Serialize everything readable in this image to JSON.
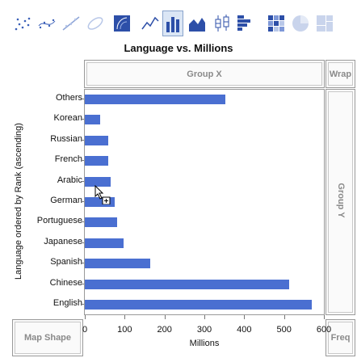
{
  "toolbar": {
    "buttons": [
      {
        "icon": "points-icon",
        "selected": false
      },
      {
        "icon": "smoother-icon",
        "selected": false
      },
      {
        "icon": "line-of-fit-icon",
        "selected": false
      },
      {
        "icon": "ellipse-icon",
        "selected": false
      },
      {
        "icon": "contour-icon",
        "selected": false
      },
      {
        "icon": "line-icon",
        "selected": false
      },
      {
        "icon": "bar-icon",
        "selected": true
      },
      {
        "icon": "area-icon",
        "selected": false
      },
      {
        "icon": "box-plot-icon",
        "selected": false
      },
      {
        "icon": "histogram-icon",
        "selected": false
      },
      {
        "icon": "heatmap-icon",
        "selected": false
      },
      {
        "icon": "pie-icon",
        "selected": false
      },
      {
        "icon": "treemap-icon",
        "selected": false
      }
    ]
  },
  "drop_zones": {
    "group_x": "Group X",
    "group_y": "Group Y",
    "wrap": "Wrap",
    "map_shape": "Map Shape",
    "freq": "Freq"
  },
  "colors": {
    "bar": "#4a6fd1",
    "accent": "#dbe6f5"
  },
  "chart_data": {
    "type": "bar",
    "orientation": "horizontal",
    "title": "Language vs. Millions",
    "xlabel": "Millions",
    "ylabel": "Language ordered by Rank (ascending)",
    "categories": [
      "Others",
      "Korean",
      "Russian",
      "French",
      "Arabic",
      "German",
      "Portuguese",
      "Japanese",
      "Spanish",
      "Chinese",
      "English"
    ],
    "values": [
      353,
      38,
      58,
      59,
      65,
      75,
      82,
      98,
      165,
      513,
      570
    ],
    "xlim": [
      0,
      600
    ],
    "xticks": [
      "0",
      "100",
      "200",
      "300",
      "400",
      "500",
      "600"
    ]
  }
}
